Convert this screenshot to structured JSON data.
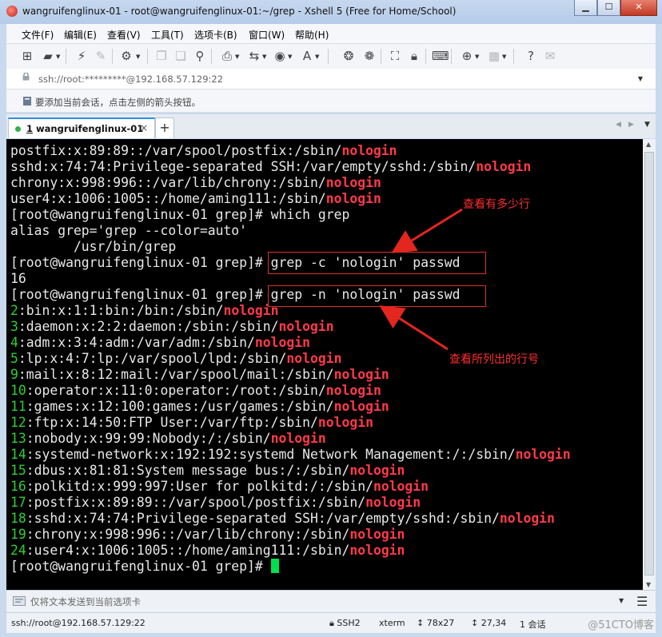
{
  "window": {
    "title": "wangruifenglinux-01 - root@wangruifenglinux-01:~/grep - Xshell 5 (Free for Home/School)",
    "buttons": {
      "minimize": "▁",
      "maximize": "☐",
      "close": "✕"
    }
  },
  "menu": {
    "items": [
      "文件(F)",
      "编辑(E)",
      "查看(V)",
      "工具(T)",
      "选项卡(B)",
      "窗口(W)",
      "帮助(H)"
    ]
  },
  "toolbar": {
    "icons": [
      "new-session-icon",
      "open-folder-icon",
      "connect-icon",
      "disconnect-icon",
      "properties-icon",
      "copy-icon",
      "paste-icon",
      "find-icon",
      "print-icon",
      "transfer-icon",
      "globe-icon",
      "font-icon",
      "xftp-icon",
      "xmanager-icon",
      "fullscreen-icon",
      "lock-icon",
      "keyboard-icon",
      "add-tab-icon",
      "layout-icon",
      "help-icon",
      "chat-icon"
    ]
  },
  "address": {
    "value": "ssh://root:*********@192.168.57.129:22"
  },
  "hint": {
    "text": "要添加当前会话，点击左侧的箭头按钮。"
  },
  "tabs": {
    "active_number": "1",
    "active_name": " wangruifenglinux-01",
    "close": "×",
    "add": "+",
    "prev": "◀",
    "next": "▶",
    "menu": "▼"
  },
  "terminal": {
    "lines": [
      [
        {
          "t": "postfix:x:89:89::/var/spool/postfix:/sbin/"
        },
        {
          "t": "nologin",
          "c": "hl"
        }
      ],
      [
        {
          "t": "sshd:x:74:74:Privilege-separated SSH:/var/empty/sshd:/sbin/"
        },
        {
          "t": "nologin",
          "c": "hl"
        }
      ],
      [
        {
          "t": "chrony:x:998:996::/var/lib/chrony:/sbin/"
        },
        {
          "t": "nologin",
          "c": "hl"
        }
      ],
      [
        {
          "t": "user4:x:1006:1005::/home/aming111:/sbin/"
        },
        {
          "t": "nologin",
          "c": "hl"
        }
      ],
      [
        {
          "t": "[root@wangruifenglinux-01 grep]# which grep"
        }
      ],
      [
        {
          "t": "alias grep='grep --color=auto'"
        }
      ],
      [
        {
          "t": "        /usr/bin/grep"
        }
      ],
      [
        {
          "t": "[root@wangruifenglinux-01 grep]# grep -c 'nologin' passwd"
        }
      ],
      [
        {
          "t": "16"
        }
      ],
      [
        {
          "t": "[root@wangruifenglinux-01 grep]# grep -n 'nologin' passwd"
        }
      ],
      [
        {
          "t": "2",
          "c": "ln"
        },
        {
          "t": ":bin:x:1:1:bin:/bin:/sbin/"
        },
        {
          "t": "nologin",
          "c": "hl"
        }
      ],
      [
        {
          "t": "3",
          "c": "ln"
        },
        {
          "t": ":daemon:x:2:2:daemon:/sbin:/sbin/"
        },
        {
          "t": "nologin",
          "c": "hl"
        }
      ],
      [
        {
          "t": "4",
          "c": "ln"
        },
        {
          "t": ":adm:x:3:4:adm:/var/adm:/sbin/"
        },
        {
          "t": "nologin",
          "c": "hl"
        }
      ],
      [
        {
          "t": "5",
          "c": "ln"
        },
        {
          "t": ":lp:x:4:7:lp:/var/spool/lpd:/sbin/"
        },
        {
          "t": "nologin",
          "c": "hl"
        }
      ],
      [
        {
          "t": "9",
          "c": "ln"
        },
        {
          "t": ":mail:x:8:12:mail:/var/spool/mail:/sbin/"
        },
        {
          "t": "nologin",
          "c": "hl"
        }
      ],
      [
        {
          "t": "10",
          "c": "ln"
        },
        {
          "t": ":operator:x:11:0:operator:/root:/sbin/"
        },
        {
          "t": "nologin",
          "c": "hl"
        }
      ],
      [
        {
          "t": "11",
          "c": "ln"
        },
        {
          "t": ":games:x:12:100:games:/usr/games:/sbin/"
        },
        {
          "t": "nologin",
          "c": "hl"
        }
      ],
      [
        {
          "t": "12",
          "c": "ln"
        },
        {
          "t": ":ftp:x:14:50:FTP User:/var/ftp:/sbin/"
        },
        {
          "t": "nologin",
          "c": "hl"
        }
      ],
      [
        {
          "t": "13",
          "c": "ln"
        },
        {
          "t": ":nobody:x:99:99:Nobody:/:/sbin/"
        },
        {
          "t": "nologin",
          "c": "hl"
        }
      ],
      [
        {
          "t": "14",
          "c": "ln"
        },
        {
          "t": ":systemd-network:x:192:192:systemd Network Management:/:/sbin/"
        },
        {
          "t": "nologin",
          "c": "hl"
        }
      ],
      [
        {
          "t": "15",
          "c": "ln"
        },
        {
          "t": ":dbus:x:81:81:System message bus:/:/sbin/"
        },
        {
          "t": "nologin",
          "c": "hl"
        }
      ],
      [
        {
          "t": "16",
          "c": "ln"
        },
        {
          "t": ":polkitd:x:999:997:User for polkitd:/:/sbin/"
        },
        {
          "t": "nologin",
          "c": "hl"
        }
      ],
      [
        {
          "t": "17",
          "c": "ln"
        },
        {
          "t": ":postfix:x:89:89::/var/spool/postfix:/sbin/"
        },
        {
          "t": "nologin",
          "c": "hl"
        }
      ],
      [
        {
          "t": "18",
          "c": "ln"
        },
        {
          "t": ":sshd:x:74:74:Privilege-separated SSH:/var/empty/sshd:/sbin/"
        },
        {
          "t": "nologin",
          "c": "hl"
        }
      ],
      [
        {
          "t": "19",
          "c": "ln"
        },
        {
          "t": ":chrony:x:998:996::/var/lib/chrony:/sbin/"
        },
        {
          "t": "nologin",
          "c": "hl"
        }
      ],
      [
        {
          "t": "24",
          "c": "ln"
        },
        {
          "t": ":user4:x:1006:1005::/home/aming111:/sbin/"
        },
        {
          "t": "nologin",
          "c": "hl"
        }
      ],
      [
        {
          "t": "[root@wangruifenglinux-01 grep]# "
        },
        {
          "t": "",
          "c": "cursor"
        }
      ]
    ]
  },
  "annotations": {
    "count_label": "查看有多少行",
    "line_number_label": "查看所列出的行号"
  },
  "compose": {
    "placeholder": "仅将文本发送到当前选项卡"
  },
  "status": {
    "connection": "ssh://root@192.168.57.129:22",
    "protocol": "SSH2",
    "terminal_type": "xterm",
    "size": "78x27",
    "cursor_pos": "27,34",
    "sessions": "1 会话",
    "watermark": "@51CTO博客"
  },
  "colors": {
    "keyword_highlight": "#ff3a48",
    "line_number": "#2fd02f",
    "cursor": "#00e04f",
    "annotation": "#ff2e2e",
    "tab_accent": "#2f8ede"
  }
}
